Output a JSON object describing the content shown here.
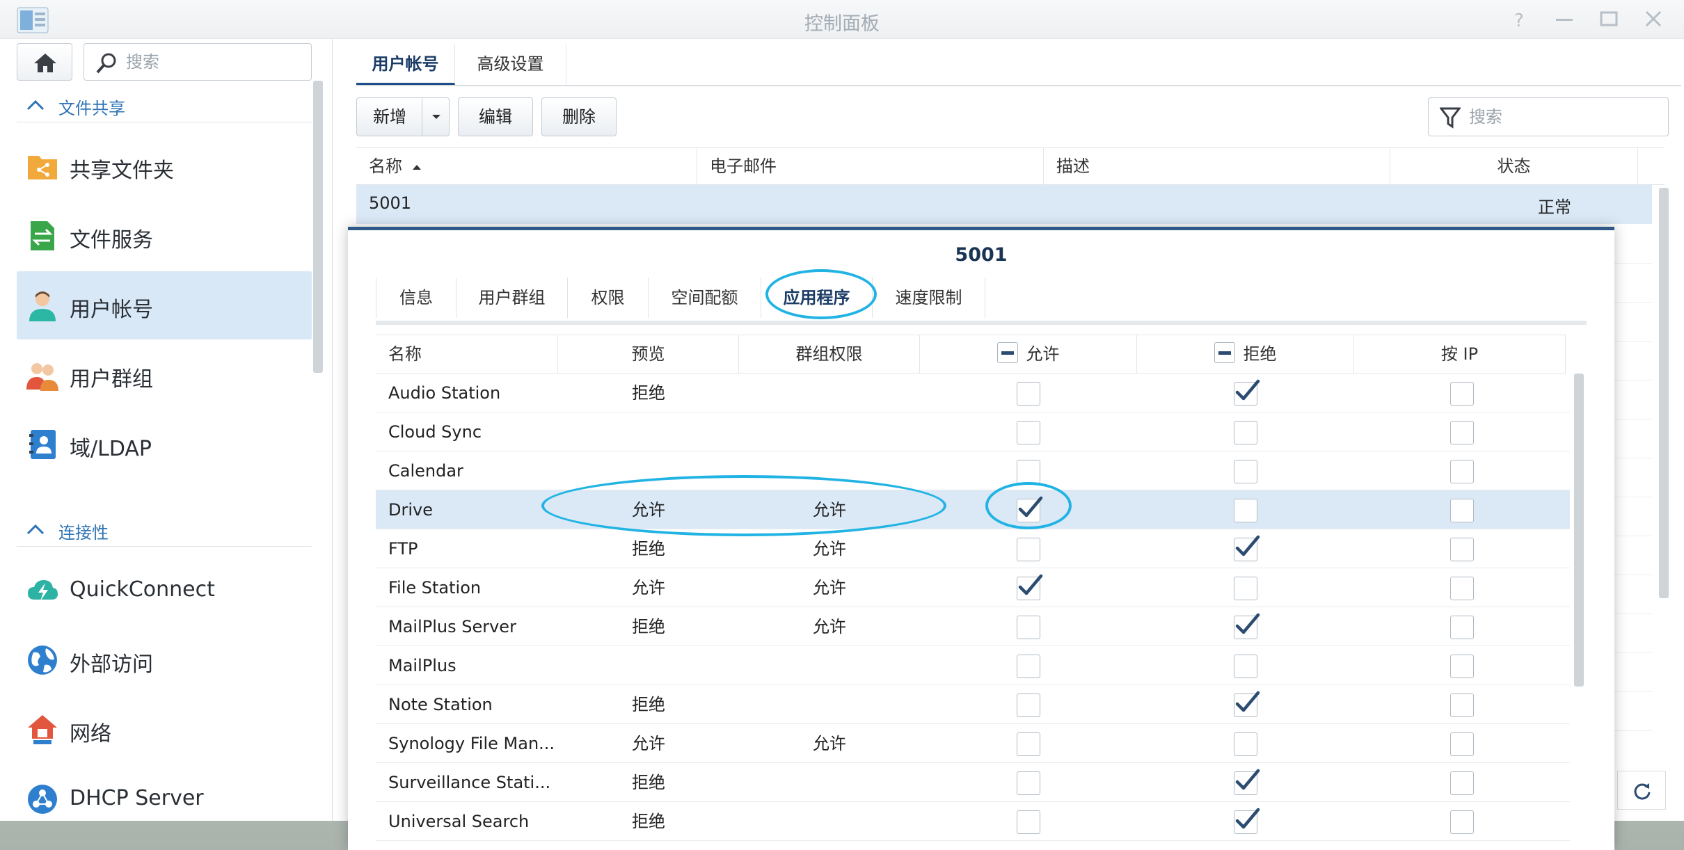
{
  "window": {
    "title": "控制面板"
  },
  "sidebar": {
    "search_placeholder": "搜索",
    "sections": [
      {
        "label": "文件共享"
      },
      {
        "label": "连接性"
      }
    ],
    "items": [
      {
        "label": "共享文件夹",
        "icon": "shared-folder-icon"
      },
      {
        "label": "文件服务",
        "icon": "file-services-icon"
      },
      {
        "label": "用户帐号",
        "icon": "user-icon",
        "active": true
      },
      {
        "label": "用户群组",
        "icon": "group-icon"
      },
      {
        "label": "域/LDAP",
        "icon": "ldap-icon"
      },
      {
        "label": "QuickConnect",
        "icon": "quickconnect-icon"
      },
      {
        "label": "外部访问",
        "icon": "globe-icon"
      },
      {
        "label": "网络",
        "icon": "network-icon"
      },
      {
        "label": "DHCP Server",
        "icon": "dhcp-icon"
      }
    ]
  },
  "main": {
    "tabs": [
      {
        "label": "用户帐号",
        "active": true
      },
      {
        "label": "高级设置"
      }
    ],
    "toolbar": {
      "add": "新增",
      "edit": "编辑",
      "delete": "删除",
      "search_placeholder": "搜索"
    },
    "columns": {
      "name": "名称",
      "email": "电子邮件",
      "description": "描述",
      "status": "状态"
    },
    "user": {
      "name": "5001",
      "status": "正常"
    }
  },
  "dialog": {
    "title": "5001",
    "tabs": [
      "信息",
      "用户群组",
      "权限",
      "空间配额",
      "应用程序",
      "速度限制"
    ],
    "active_tab": "应用程序",
    "columns": {
      "name": "名称",
      "preview": "预览",
      "group_perm": "群组权限",
      "allow": "允许",
      "deny": "拒绝",
      "by_ip": "按 IP"
    },
    "apps": [
      {
        "name": "Audio Station",
        "preview": "拒绝",
        "group": "",
        "allow": false,
        "deny": true,
        "ip": false
      },
      {
        "name": "Cloud Sync",
        "preview": "",
        "group": "",
        "allow": false,
        "deny": false,
        "ip": false
      },
      {
        "name": "Calendar",
        "preview": "",
        "group": "",
        "allow": false,
        "deny": false,
        "ip": false
      },
      {
        "name": "Drive",
        "preview": "允许",
        "group": "允许",
        "allow": true,
        "deny": false,
        "ip": false,
        "highlighted": true
      },
      {
        "name": "FTP",
        "preview": "拒绝",
        "group": "允许",
        "allow": false,
        "deny": true,
        "ip": false
      },
      {
        "name": "File Station",
        "preview": "允许",
        "group": "允许",
        "allow": true,
        "deny": false,
        "ip": false
      },
      {
        "name": "MailPlus Server",
        "preview": "拒绝",
        "group": "允许",
        "allow": false,
        "deny": true,
        "ip": false
      },
      {
        "name": "MailPlus",
        "preview": "",
        "group": "",
        "allow": false,
        "deny": false,
        "ip": false
      },
      {
        "name": "Note Station",
        "preview": "拒绝",
        "group": "",
        "allow": false,
        "deny": true,
        "ip": false
      },
      {
        "name": "Synology File Man...",
        "preview": "允许",
        "group": "允许",
        "allow": false,
        "deny": false,
        "ip": false
      },
      {
        "name": "Surveillance Stati...",
        "preview": "拒绝",
        "group": "",
        "allow": false,
        "deny": true,
        "ip": false
      },
      {
        "name": "Universal Search",
        "preview": "拒绝",
        "group": "",
        "allow": false,
        "deny": true,
        "ip": false
      }
    ]
  },
  "colors": {
    "accent": "#2f74b5",
    "selection": "#dbe9f7",
    "annotation": "#21b3e4",
    "check": "#2b4c70"
  }
}
